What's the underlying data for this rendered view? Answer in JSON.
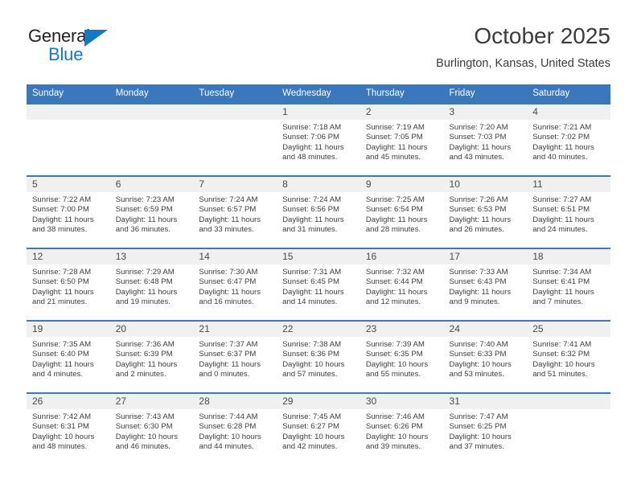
{
  "brand": {
    "name_part1": "General",
    "name_part2": "Blue",
    "triangle_color": "#1279c5"
  },
  "header": {
    "title": "October 2025",
    "subtitle": "Burlington, Kansas, United States",
    "accent_color": "#3a77bb"
  },
  "calendar": {
    "weekday_headers": [
      "Sunday",
      "Monday",
      "Tuesday",
      "Wednesday",
      "Thursday",
      "Friday",
      "Saturday"
    ],
    "weeks": [
      [
        {
          "day": "",
          "sunrise": "",
          "sunset": "",
          "daylight": "",
          "empty": true
        },
        {
          "day": "",
          "sunrise": "",
          "sunset": "",
          "daylight": "",
          "empty": true
        },
        {
          "day": "",
          "sunrise": "",
          "sunset": "",
          "daylight": "",
          "empty": true
        },
        {
          "day": "1",
          "sunrise": "Sunrise: 7:18 AM",
          "sunset": "Sunset: 7:06 PM",
          "daylight": "Daylight: 11 hours and 48 minutes."
        },
        {
          "day": "2",
          "sunrise": "Sunrise: 7:19 AM",
          "sunset": "Sunset: 7:05 PM",
          "daylight": "Daylight: 11 hours and 45 minutes."
        },
        {
          "day": "3",
          "sunrise": "Sunrise: 7:20 AM",
          "sunset": "Sunset: 7:03 PM",
          "daylight": "Daylight: 11 hours and 43 minutes."
        },
        {
          "day": "4",
          "sunrise": "Sunrise: 7:21 AM",
          "sunset": "Sunset: 7:02 PM",
          "daylight": "Daylight: 11 hours and 40 minutes."
        }
      ],
      [
        {
          "day": "5",
          "sunrise": "Sunrise: 7:22 AM",
          "sunset": "Sunset: 7:00 PM",
          "daylight": "Daylight: 11 hours and 38 minutes."
        },
        {
          "day": "6",
          "sunrise": "Sunrise: 7:23 AM",
          "sunset": "Sunset: 6:59 PM",
          "daylight": "Daylight: 11 hours and 36 minutes."
        },
        {
          "day": "7",
          "sunrise": "Sunrise: 7:24 AM",
          "sunset": "Sunset: 6:57 PM",
          "daylight": "Daylight: 11 hours and 33 minutes."
        },
        {
          "day": "8",
          "sunrise": "Sunrise: 7:24 AM",
          "sunset": "Sunset: 6:56 PM",
          "daylight": "Daylight: 11 hours and 31 minutes."
        },
        {
          "day": "9",
          "sunrise": "Sunrise: 7:25 AM",
          "sunset": "Sunset: 6:54 PM",
          "daylight": "Daylight: 11 hours and 28 minutes."
        },
        {
          "day": "10",
          "sunrise": "Sunrise: 7:26 AM",
          "sunset": "Sunset: 6:53 PM",
          "daylight": "Daylight: 11 hours and 26 minutes."
        },
        {
          "day": "11",
          "sunrise": "Sunrise: 7:27 AM",
          "sunset": "Sunset: 6:51 PM",
          "daylight": "Daylight: 11 hours and 24 minutes."
        }
      ],
      [
        {
          "day": "12",
          "sunrise": "Sunrise: 7:28 AM",
          "sunset": "Sunset: 6:50 PM",
          "daylight": "Daylight: 11 hours and 21 minutes."
        },
        {
          "day": "13",
          "sunrise": "Sunrise: 7:29 AM",
          "sunset": "Sunset: 6:48 PM",
          "daylight": "Daylight: 11 hours and 19 minutes."
        },
        {
          "day": "14",
          "sunrise": "Sunrise: 7:30 AM",
          "sunset": "Sunset: 6:47 PM",
          "daylight": "Daylight: 11 hours and 16 minutes."
        },
        {
          "day": "15",
          "sunrise": "Sunrise: 7:31 AM",
          "sunset": "Sunset: 6:45 PM",
          "daylight": "Daylight: 11 hours and 14 minutes."
        },
        {
          "day": "16",
          "sunrise": "Sunrise: 7:32 AM",
          "sunset": "Sunset: 6:44 PM",
          "daylight": "Daylight: 11 hours and 12 minutes."
        },
        {
          "day": "17",
          "sunrise": "Sunrise: 7:33 AM",
          "sunset": "Sunset: 6:43 PM",
          "daylight": "Daylight: 11 hours and 9 minutes."
        },
        {
          "day": "18",
          "sunrise": "Sunrise: 7:34 AM",
          "sunset": "Sunset: 6:41 PM",
          "daylight": "Daylight: 11 hours and 7 minutes."
        }
      ],
      [
        {
          "day": "19",
          "sunrise": "Sunrise: 7:35 AM",
          "sunset": "Sunset: 6:40 PM",
          "daylight": "Daylight: 11 hours and 4 minutes."
        },
        {
          "day": "20",
          "sunrise": "Sunrise: 7:36 AM",
          "sunset": "Sunset: 6:39 PM",
          "daylight": "Daylight: 11 hours and 2 minutes."
        },
        {
          "day": "21",
          "sunrise": "Sunrise: 7:37 AM",
          "sunset": "Sunset: 6:37 PM",
          "daylight": "Daylight: 11 hours and 0 minutes."
        },
        {
          "day": "22",
          "sunrise": "Sunrise: 7:38 AM",
          "sunset": "Sunset: 6:36 PM",
          "daylight": "Daylight: 10 hours and 57 minutes."
        },
        {
          "day": "23",
          "sunrise": "Sunrise: 7:39 AM",
          "sunset": "Sunset: 6:35 PM",
          "daylight": "Daylight: 10 hours and 55 minutes."
        },
        {
          "day": "24",
          "sunrise": "Sunrise: 7:40 AM",
          "sunset": "Sunset: 6:33 PM",
          "daylight": "Daylight: 10 hours and 53 minutes."
        },
        {
          "day": "25",
          "sunrise": "Sunrise: 7:41 AM",
          "sunset": "Sunset: 6:32 PM",
          "daylight": "Daylight: 10 hours and 51 minutes."
        }
      ],
      [
        {
          "day": "26",
          "sunrise": "Sunrise: 7:42 AM",
          "sunset": "Sunset: 6:31 PM",
          "daylight": "Daylight: 10 hours and 48 minutes."
        },
        {
          "day": "27",
          "sunrise": "Sunrise: 7:43 AM",
          "sunset": "Sunset: 6:30 PM",
          "daylight": "Daylight: 10 hours and 46 minutes."
        },
        {
          "day": "28",
          "sunrise": "Sunrise: 7:44 AM",
          "sunset": "Sunset: 6:28 PM",
          "daylight": "Daylight: 10 hours and 44 minutes."
        },
        {
          "day": "29",
          "sunrise": "Sunrise: 7:45 AM",
          "sunset": "Sunset: 6:27 PM",
          "daylight": "Daylight: 10 hours and 42 minutes."
        },
        {
          "day": "30",
          "sunrise": "Sunrise: 7:46 AM",
          "sunset": "Sunset: 6:26 PM",
          "daylight": "Daylight: 10 hours and 39 minutes."
        },
        {
          "day": "31",
          "sunrise": "Sunrise: 7:47 AM",
          "sunset": "Sunset: 6:25 PM",
          "daylight": "Daylight: 10 hours and 37 minutes."
        },
        {
          "day": "",
          "sunrise": "",
          "sunset": "",
          "daylight": "",
          "empty": true
        }
      ]
    ]
  }
}
